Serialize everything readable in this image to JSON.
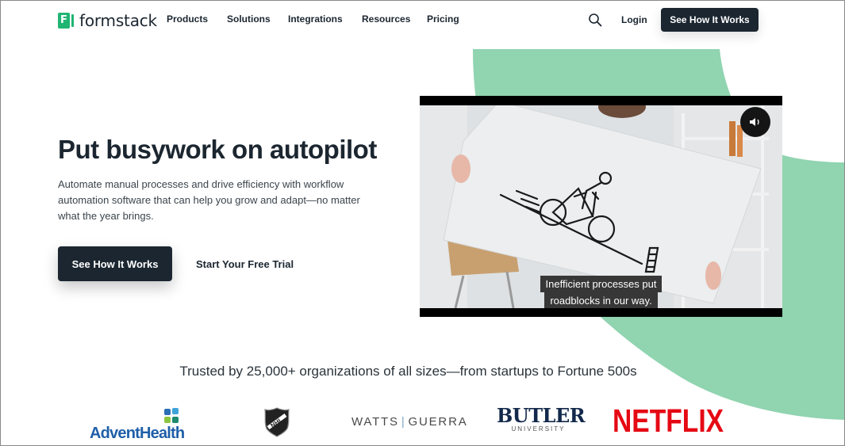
{
  "header": {
    "logo_text": "formstack",
    "nav": [
      "Products",
      "Solutions",
      "Integrations",
      "Resources",
      "Pricing"
    ],
    "login_label": "Login",
    "cta_label": "See How It Works"
  },
  "hero": {
    "title": "Put busywork on autopilot",
    "description": "Automate manual processes and drive efficiency with workflow automation software that can help you grow and adapt—no matter what the year brings.",
    "primary_cta": "See How It Works",
    "secondary_cta": "Start Your Free Trial"
  },
  "video": {
    "caption_line1": "Inefficient processes put",
    "caption_line2": "roadblocks in our way.",
    "mute_icon": "speaker-icon"
  },
  "trusted": {
    "text": "Trusted by 25,000+ organizations of all sizes—from startups to Fortune 500s",
    "logos": {
      "advent": "AdventHealth",
      "nhl": "NHL",
      "watts_left": "WATTS",
      "watts_right": "GUERRA",
      "butler_main": "BUTLER",
      "butler_sub": "UNIVERSITY",
      "netflix": "NETFLIX"
    }
  },
  "colors": {
    "brand_green": "#21b573",
    "accent_shape": "#90d4b0",
    "dark": "#1b2630",
    "netflix_red": "#e50914",
    "advent_blue": "#1f5fa8"
  }
}
